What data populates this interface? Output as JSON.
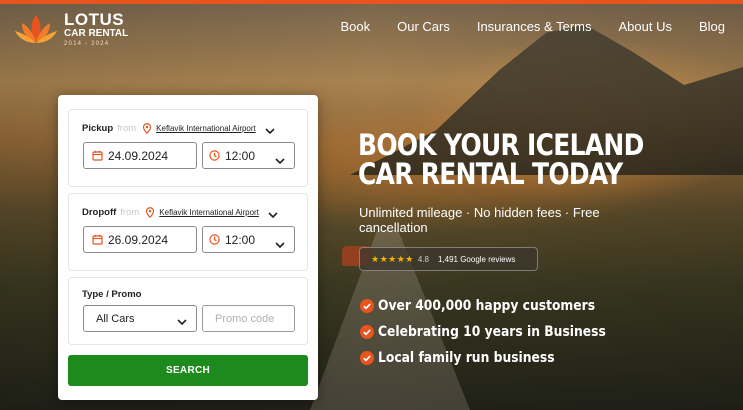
{
  "brand": {
    "name": "LOTUS",
    "subtitle": "CAR RENTAL",
    "years": "2014 - 2024",
    "accent": "#e8541e"
  },
  "nav": {
    "items": [
      {
        "label": "Book"
      },
      {
        "label": "Our Cars"
      },
      {
        "label": "Insurances & Terms"
      },
      {
        "label": "About Us"
      },
      {
        "label": "Blog"
      }
    ]
  },
  "booking": {
    "pickup": {
      "label": "Pickup",
      "from": "from",
      "location": "Keflavik International Airport",
      "date": "24.09.2024",
      "time": "12:00"
    },
    "dropoff": {
      "label": "Dropoff",
      "from": "from",
      "location": "Keflavik International Airport",
      "date": "26.09.2024",
      "time": "12:00"
    },
    "type": {
      "label": "Type / Promo",
      "selected": "All Cars",
      "promo_placeholder": "Promo code"
    },
    "search_label": "SEARCH",
    "search_color": "#1c8a1c"
  },
  "hero": {
    "headline_1": "BOOK YOUR ICELAND",
    "headline_2": "CAR RENTAL TODAY",
    "tagline": "Unlimited mileage · No hidden fees · Free cancellation",
    "reviews": {
      "stars": "★★★★★",
      "rating": "4.8",
      "count": "1,491 Google reviews"
    },
    "bullets": [
      {
        "text": "Over 400,000 happy customers"
      },
      {
        "text": "Celebrating 10 years in Business"
      },
      {
        "text": "Local family run business"
      }
    ]
  }
}
